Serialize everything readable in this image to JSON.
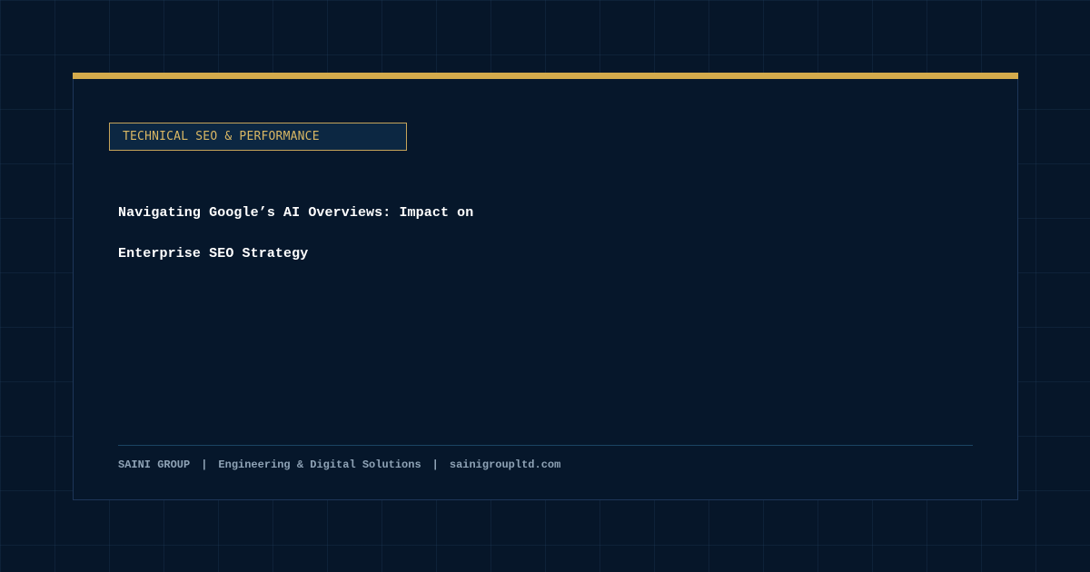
{
  "colors": {
    "background": "#061629",
    "card": "#06172b",
    "accent": "#d4aa4c",
    "title": "#ffffff",
    "footer_text": "#8fa3b6"
  },
  "category": "TECHNICAL SEO & PERFORMANCE",
  "title": "Navigating Google’s AI Overviews: Impact on Enterprise SEO Strategy",
  "footer": {
    "brand": "SAINI GROUP",
    "separator": "|",
    "tagline": "Engineering & Digital Solutions",
    "website": "sainigroupltd.com"
  }
}
